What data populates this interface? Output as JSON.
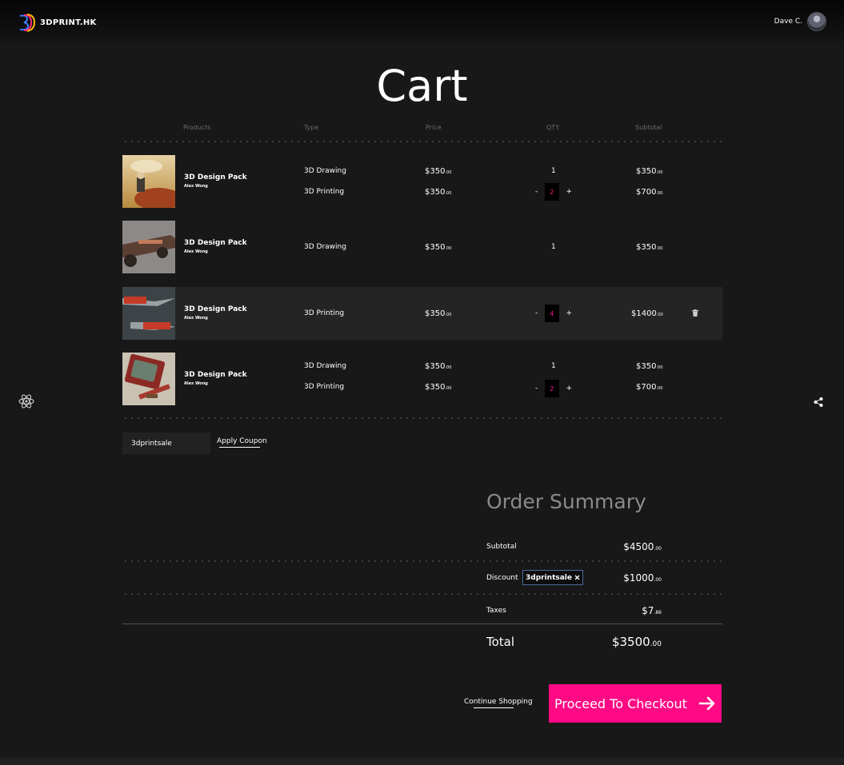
{
  "header": {
    "brand": "3DPRINT.HK",
    "user_name": "Dave C."
  },
  "page_title": "Cart",
  "table_headers": {
    "products": "Products",
    "type": "Type",
    "price": "Price",
    "qty": "QTY.",
    "subtotal": "Subtotal"
  },
  "items": [
    {
      "name": "3D Design Pack",
      "author": "Alex Wong",
      "lines": [
        {
          "type": "3D Drawing",
          "price": "$350",
          "cents": ".00",
          "qty": "1",
          "subtotal": "$350",
          "subtotal_cents": ".00"
        },
        {
          "type": "3D Printing",
          "price": "$350",
          "cents": ".00",
          "qty": "2",
          "subtotal": "$700",
          "subtotal_cents": ".00"
        }
      ]
    },
    {
      "name": "3D Design Pack",
      "author": "Alex Wong",
      "lines": [
        {
          "type": "3D Drawing",
          "price": "$350",
          "cents": ".00",
          "qty": "1",
          "subtotal": "$350",
          "subtotal_cents": ".00"
        }
      ]
    },
    {
      "name": "3D Design Pack",
      "author": "Alex Wong",
      "lines": [
        {
          "type": "3D Printing",
          "price": "$350",
          "cents": ".00",
          "qty": "4",
          "subtotal": "$1400",
          "subtotal_cents": ".00"
        }
      ]
    },
    {
      "name": "3D Design Pack",
      "author": "Alex Wong",
      "lines": [
        {
          "type": "3D Drawing",
          "price": "$350",
          "cents": ".00",
          "qty": "1",
          "subtotal": "$350",
          "subtotal_cents": ".00"
        },
        {
          "type": "3D Printing",
          "price": "$350",
          "cents": ".00",
          "qty": "2",
          "subtotal": "$700",
          "subtotal_cents": ".00"
        }
      ]
    }
  ],
  "qty_minus": "-",
  "qty_plus": "+",
  "coupon": {
    "value": "3dprintsale",
    "apply_label": "Apply Coupon"
  },
  "summary": {
    "title": "Order Summary",
    "subtotal_label": "Subtotal",
    "subtotal_value": "$4500",
    "subtotal_cents": ".00",
    "discount_label": "Discount",
    "discount_tag": "3dprintsale",
    "discount_value": "$1000",
    "discount_cents": ".00",
    "taxes_label": "Taxes",
    "taxes_value": "$7",
    "taxes_cents": ".86",
    "total_label": "Total",
    "total_value": "$3500",
    "total_cents": ".00"
  },
  "actions": {
    "continue_label": "Continue Shopping",
    "checkout_label": "Proceed To Checkout"
  },
  "colors": {
    "background": "#181818",
    "accent": "#ff0a84",
    "qty_text": "#ff1493",
    "highlight_row": "#242424"
  },
  "icons": [
    "logo-icon",
    "avatar",
    "trash-icon",
    "remove-tag-icon",
    "arrow-right-icon",
    "atom-icon",
    "share-icon"
  ]
}
